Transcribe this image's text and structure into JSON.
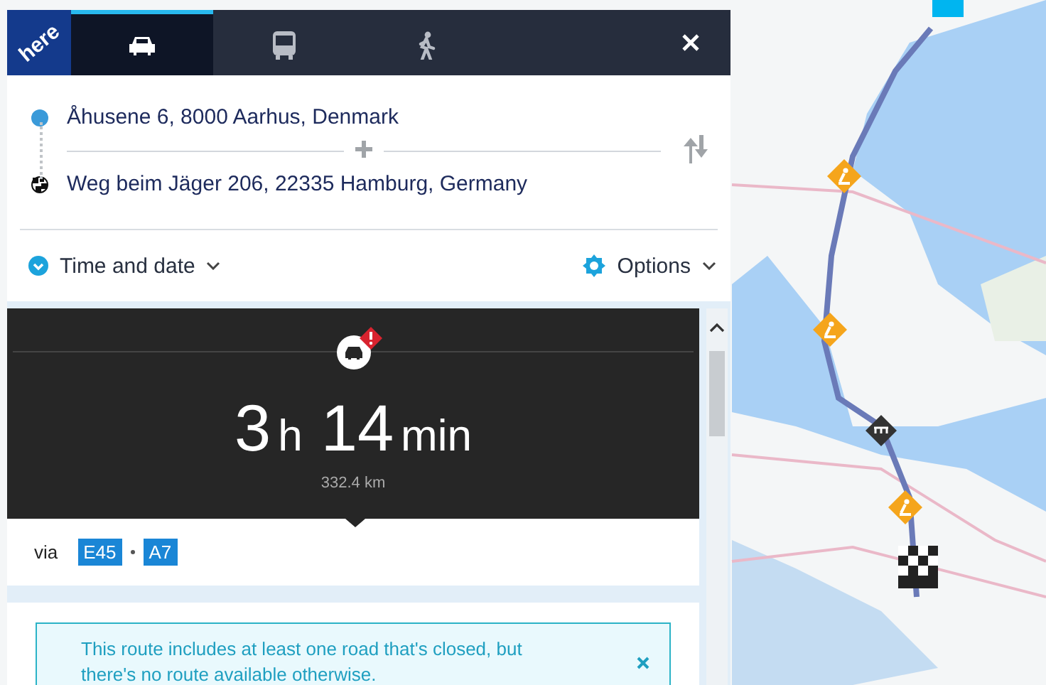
{
  "header": {
    "logo": "here",
    "tabs": [
      {
        "kind": "car",
        "selected": true
      },
      {
        "kind": "bus",
        "selected": false
      },
      {
        "kind": "walk",
        "selected": false
      }
    ]
  },
  "route": {
    "waypoints": [
      {
        "kind": "start",
        "address": "Åhusene 6, 8000 Aarhus, Denmark"
      },
      {
        "kind": "destination",
        "address": "Weg beim Jäger 206, 22335 Hamburg, Germany"
      }
    ]
  },
  "time_and_date": "Time and date",
  "options": "Options",
  "summary": {
    "warning": true,
    "hours": "3",
    "hours_unit": "h",
    "minutes": "14",
    "minutes_unit": "min",
    "distance": "332.4 km",
    "via_label": "via",
    "roads": [
      "E45",
      "A7"
    ]
  },
  "alert": {
    "message": "This route includes at least one road that's closed, but there's no route available otherwise."
  }
}
